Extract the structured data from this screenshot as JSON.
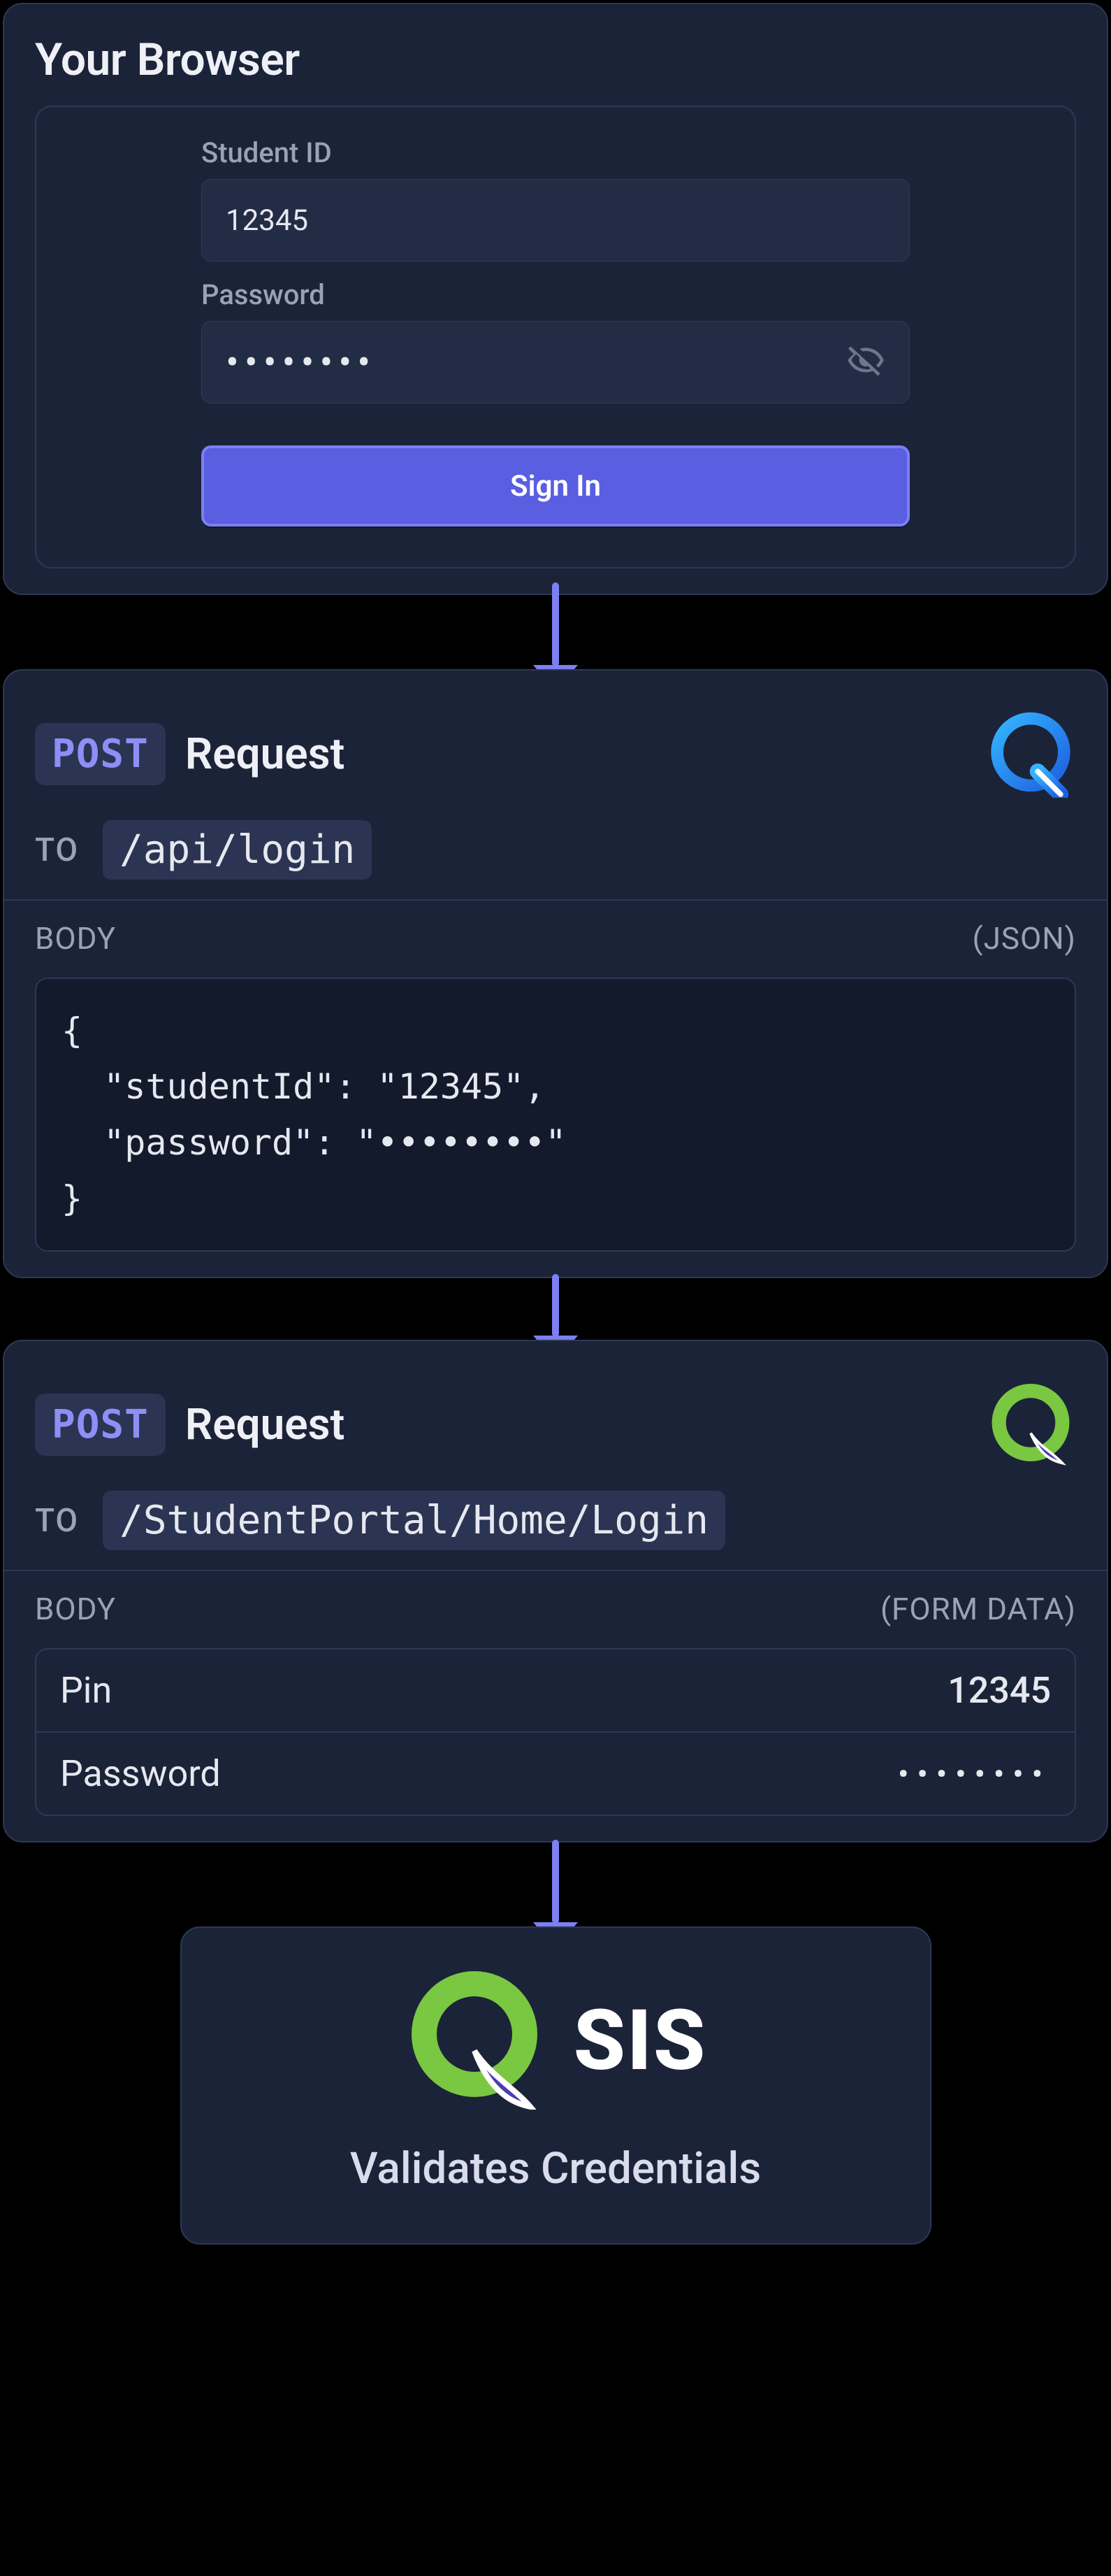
{
  "browser": {
    "title": "Your Browser",
    "student_id_label": "Student ID",
    "student_id_value": "12345",
    "password_label": "Password",
    "password_masked": "••••••••",
    "signin_label": "Sign In"
  },
  "req1": {
    "method": "POST",
    "request_word": "Request",
    "to_label": "TO",
    "path": "/api/login",
    "body_label": "BODY",
    "body_type": "(JSON)",
    "json_text": "{\n  \"studentId\": \"12345\",\n  \"password\": \"••••••••\"\n}"
  },
  "req2": {
    "method": "POST",
    "request_word": "Request",
    "to_label": "TO",
    "path": "/StudentPortal/Home/Login",
    "body_label": "BODY",
    "body_type": "(FORM DATA)",
    "rows": [
      {
        "key": "Pin",
        "value": "12345"
      },
      {
        "key": "Password",
        "value": "••••••••"
      }
    ]
  },
  "sis": {
    "name": "SIS",
    "subtitle": "Validates Credentials"
  }
}
